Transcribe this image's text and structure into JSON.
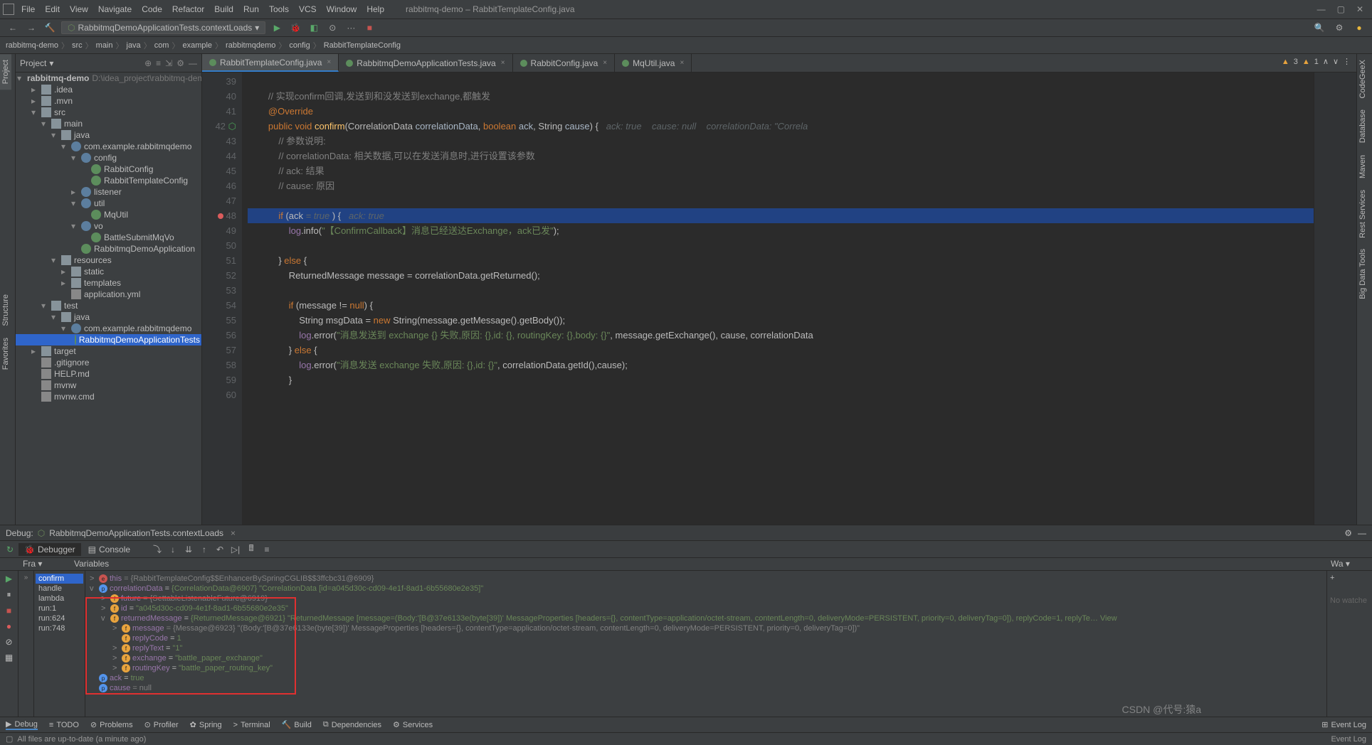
{
  "window": {
    "title": "rabbitmq-demo – RabbitTemplateConfig.java"
  },
  "menu": [
    "File",
    "Edit",
    "View",
    "Navigate",
    "Code",
    "Refactor",
    "Build",
    "Run",
    "Tools",
    "VCS",
    "Window",
    "Help"
  ],
  "runConfig": "RabbitmqDemoApplicationTests.contextLoads",
  "breadcrumb": [
    "rabbitmq-demo",
    "src",
    "main",
    "java",
    "com",
    "example",
    "rabbitmqdemo",
    "config",
    "RabbitTemplateConfig"
  ],
  "project": {
    "label": "Project",
    "root": {
      "name": "rabbitmq-demo",
      "hint": "D:\\idea_project\\rabbitmq-demo"
    },
    "nodes": [
      {
        "d": 1,
        "t": "folder",
        "name": ".idea"
      },
      {
        "d": 1,
        "t": "folder",
        "name": ".mvn"
      },
      {
        "d": 1,
        "t": "folder",
        "name": "src",
        "open": true
      },
      {
        "d": 2,
        "t": "folder",
        "name": "main",
        "open": true
      },
      {
        "d": 3,
        "t": "folder",
        "name": "java",
        "open": true
      },
      {
        "d": 4,
        "t": "pkg",
        "name": "com.example.rabbitmqdemo",
        "open": true
      },
      {
        "d": 5,
        "t": "pkg",
        "name": "config",
        "open": true
      },
      {
        "d": 6,
        "t": "class",
        "name": "RabbitConfig"
      },
      {
        "d": 6,
        "t": "class",
        "name": "RabbitTemplateConfig"
      },
      {
        "d": 5,
        "t": "pkg",
        "name": "listener"
      },
      {
        "d": 5,
        "t": "pkg",
        "name": "util",
        "open": true
      },
      {
        "d": 6,
        "t": "class",
        "name": "MqUtil"
      },
      {
        "d": 5,
        "t": "pkg",
        "name": "vo",
        "open": true
      },
      {
        "d": 6,
        "t": "class",
        "name": "BattleSubmitMqVo"
      },
      {
        "d": 5,
        "t": "class",
        "name": "RabbitmqDemoApplication"
      },
      {
        "d": 3,
        "t": "folder",
        "name": "resources",
        "open": true
      },
      {
        "d": 4,
        "t": "folder",
        "name": "static"
      },
      {
        "d": 4,
        "t": "folder",
        "name": "templates"
      },
      {
        "d": 4,
        "t": "file",
        "name": "application.yml"
      },
      {
        "d": 2,
        "t": "folder",
        "name": "test",
        "open": true
      },
      {
        "d": 3,
        "t": "folder",
        "name": "java",
        "open": true
      },
      {
        "d": 4,
        "t": "pkg",
        "name": "com.example.rabbitmqdemo",
        "open": true
      },
      {
        "d": 5,
        "t": "class",
        "name": "RabbitmqDemoApplicationTests",
        "sel": true
      },
      {
        "d": 1,
        "t": "folder",
        "name": "target"
      },
      {
        "d": 1,
        "t": "file",
        "name": ".gitignore"
      },
      {
        "d": 1,
        "t": "file",
        "name": "HELP.md"
      },
      {
        "d": 1,
        "t": "file",
        "name": "mvnw"
      },
      {
        "d": 1,
        "t": "file",
        "name": "mvnw.cmd"
      }
    ]
  },
  "tabs": [
    {
      "name": "RabbitTemplateConfig.java",
      "active": true
    },
    {
      "name": "RabbitmqDemoApplicationTests.java"
    },
    {
      "name": "RabbitConfig.java"
    },
    {
      "name": "MqUtil.java"
    }
  ],
  "indicators": {
    "err": "3",
    "warn": "1"
  },
  "code": {
    "start": 39,
    "lines": [
      "",
      "        <span class='com'>// 实现confirm回调,发送到和没发送到exchange,都触发</span>",
      "        <span class='kw'>@Override</span>",
      "        <span class='kw'>public void</span> <span class='method'>confirm</span>(CorrelationData <span class='param'>correlationData</span>, <span class='kw'>boolean</span> <span class='param'>ack</span>, String <span class='param'>cause</span>) {   <span class='hint'>ack: true    cause: null    correlationData: \"Correla</span>",
      "            <span class='com'>// 参数说明:</span>",
      "            <span class='com'>// correlationData: 相关数据,可以在发送消息时,进行设置该参数</span>",
      "            <span class='com'>// ack: 结果</span>",
      "            <span class='com'>// cause: 原因</span>",
      "",
      "            <span class='kw'>if</span> (ack <span class='hint'>= true </span>) {   <span class='hint'>ack: true</span>",
      "                <span class='ident'>log</span>.info(<span class='str'>\"【ConfirmCallback】消息已经送达Exchange，ack已发\"</span>);",
      "",
      "            } <span class='kw'>else</span> {",
      "                ReturnedMessage message = correlationData.getReturned();",
      "",
      "                <span class='kw'>if</span> (message != <span class='kw'>null</span>) {",
      "                    String msgData = <span class='kw'>new</span> String(message.getMessage().getBody());",
      "                    <span class='ident'>log</span>.error(<span class='str'>\"消息发送到 exchange {} 失败,原因: {},id: {}, routingKey: {},body: {}\"</span>, message.getExchange(), cause, correlationData",
      "                } <span class='kw'>else</span> {",
      "                    <span class='ident'>log</span>.error(<span class='str'>\"消息发送 exchange 失败,原因: {},id: {}\"</span>, correlationData.getId(),cause);",
      "                }",
      ""
    ],
    "breakpointLine": 48,
    "hlLine": 48,
    "specialGutter42": true
  },
  "debug": {
    "title": "Debug:",
    "session": "RabbitmqDemoApplicationTests.contextLoads",
    "tabs": [
      "Debugger",
      "Console"
    ],
    "framesLabel": "Fra",
    "varsLabel": "Variables",
    "watchLabel": "Wa",
    "noWatchers": "No watche",
    "frames": [
      {
        "name": "confirm",
        "sel": true
      },
      {
        "name": "handle"
      },
      {
        "name": "lambda"
      },
      {
        "name": "run:1"
      },
      {
        "name": "run:624"
      },
      {
        "name": "run:748"
      }
    ],
    "vars": [
      {
        "d": 0,
        "arrow": ">",
        "badge": "e",
        "name": "this",
        "eq": " = ",
        "val": "{RabbitTemplateConfig$$EnhancerBySpringCGLIB$$3ffcbc31@6909}",
        "gray": true
      },
      {
        "d": 0,
        "arrow": "v",
        "badge": "p",
        "name": "correlationData",
        "eq": " = ",
        "val": "{CorrelationData@6907} \"CorrelationData [id=a045d30c-cd09-4e1f-8ad1-6b55680e2e35]\""
      },
      {
        "d": 1,
        "arrow": ">",
        "badge": "f",
        "name": "future",
        "eq": " = ",
        "val": "{SettableListenableFuture@6919}",
        "gray": true
      },
      {
        "d": 1,
        "arrow": ">",
        "badge": "f",
        "name": "id",
        "eq": " = ",
        "val": "\"a045d30c-cd09-4e1f-8ad1-6b55680e2e35\""
      },
      {
        "d": 1,
        "arrow": "v",
        "badge": "f",
        "name": "returnedMessage",
        "eq": " = ",
        "val": "{ReturnedMessage@6921} \"ReturnedMessage [message=(Body:'[B@37e6133e(byte[39])' MessageProperties [headers={}, contentType=application/octet-stream, contentLength=0, deliveryMode=PERSISTENT, priority=0, deliveryTag=0]), replyCode=1, replyTe… View"
      },
      {
        "d": 2,
        "arrow": ">",
        "badge": "f",
        "name": "message",
        "eq": " = ",
        "val": "{Message@6923} \"(Body:'[B@37e6133e(byte[39])' MessageProperties [headers={}, contentType=application/octet-stream, contentLength=0, deliveryMode=PERSISTENT, priority=0, deliveryTag=0])\"",
        "gray": true
      },
      {
        "d": 2,
        "arrow": "",
        "badge": "f",
        "name": "replyCode",
        "eq": " = ",
        "val": "1"
      },
      {
        "d": 2,
        "arrow": ">",
        "badge": "f",
        "name": "replyText",
        "eq": " = ",
        "val": "\"1\""
      },
      {
        "d": 2,
        "arrow": ">",
        "badge": "f",
        "name": "exchange",
        "eq": " = ",
        "val": "\"battle_paper_exchange\""
      },
      {
        "d": 2,
        "arrow": ">",
        "badge": "f",
        "name": "routingKey",
        "eq": " = ",
        "val": "\"battle_paper_routing_key\""
      },
      {
        "d": 0,
        "arrow": "",
        "badge": "p",
        "name": "ack",
        "eq": " = ",
        "val": "true"
      },
      {
        "d": 0,
        "arrow": "",
        "badge": "p",
        "name": "cause",
        "eq": " = ",
        "val": "null",
        "gray": true
      }
    ],
    "redbox": {
      "fromRow": 1,
      "toRow": 9
    }
  },
  "bottomTabs": [
    {
      "icon": "▶",
      "name": "Debug",
      "active": true
    },
    {
      "icon": "≡",
      "name": "TODO"
    },
    {
      "icon": "⊘",
      "name": "Problems"
    },
    {
      "icon": "⊙",
      "name": "Profiler"
    },
    {
      "icon": "✿",
      "name": "Spring"
    },
    {
      "icon": ">",
      "name": "Terminal"
    },
    {
      "icon": "🔨",
      "name": "Build"
    },
    {
      "icon": "⧉",
      "name": "Dependencies"
    },
    {
      "icon": "⚙",
      "name": "Services"
    }
  ],
  "status": "All files are up-to-date (a minute ago)",
  "eventLog": "Event Log",
  "watermark": "CSDN @代号:猿a",
  "sideRightTabs": [
    "CodeGeeX",
    "Database",
    "Maven",
    "Rest Services",
    "Big Data Tools"
  ]
}
